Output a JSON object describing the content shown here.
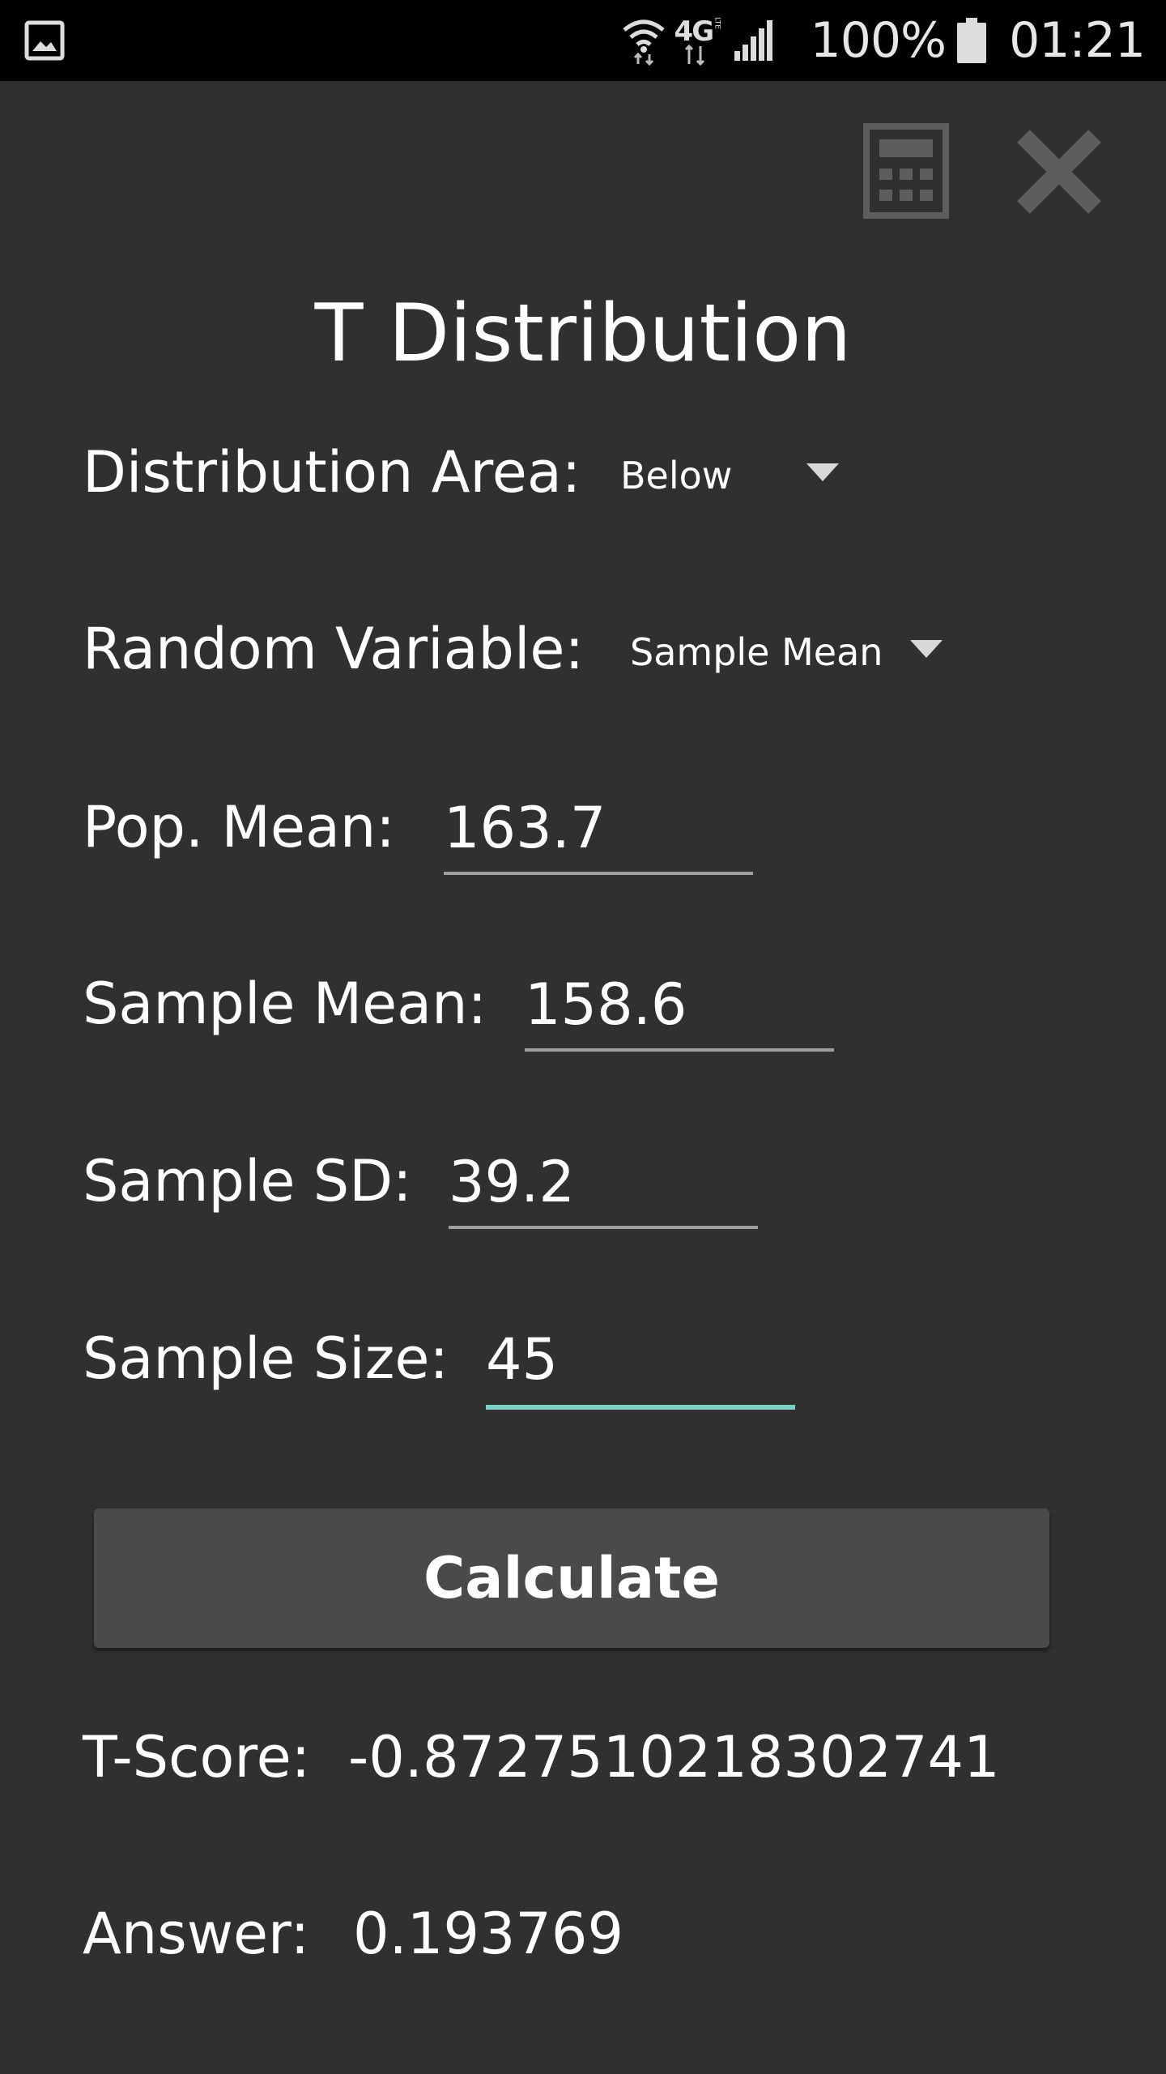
{
  "status_bar": {
    "network": "4G",
    "network_sub": "LTE",
    "battery_percent": "100%",
    "time": "01:21",
    "icons": [
      "image-icon",
      "wifi-icon",
      "4g-lte-icon",
      "signal-icon",
      "battery-icon"
    ]
  },
  "toolbar": {
    "calculator_icon": "calculator-icon",
    "close_icon": "close-icon"
  },
  "title": "T Distribution",
  "form": {
    "distribution_area": {
      "label": "Distribution Area:",
      "selected": "Below"
    },
    "random_variable": {
      "label": "Random Variable:",
      "selected": "Sample Mean"
    },
    "pop_mean": {
      "label": "Pop. Mean:",
      "value": "163.7"
    },
    "sample_mean": {
      "label": "Sample Mean:",
      "value": "158.6"
    },
    "sample_sd": {
      "label": "Sample SD:",
      "value": "39.2"
    },
    "sample_size": {
      "label": "Sample Size:",
      "value": "45"
    }
  },
  "calculate_label": "Calculate",
  "results": {
    "t_score": {
      "label": "T-Score:",
      "value": "-0.8727510218302741"
    },
    "answer": {
      "label": "Answer:",
      "value": "0.193769"
    }
  },
  "colors": {
    "background": "#303030",
    "status_bar": "#000000",
    "accent": "#7fcfc6",
    "button": "#4a4a4a",
    "icon_gray": "#5d5d5d"
  }
}
